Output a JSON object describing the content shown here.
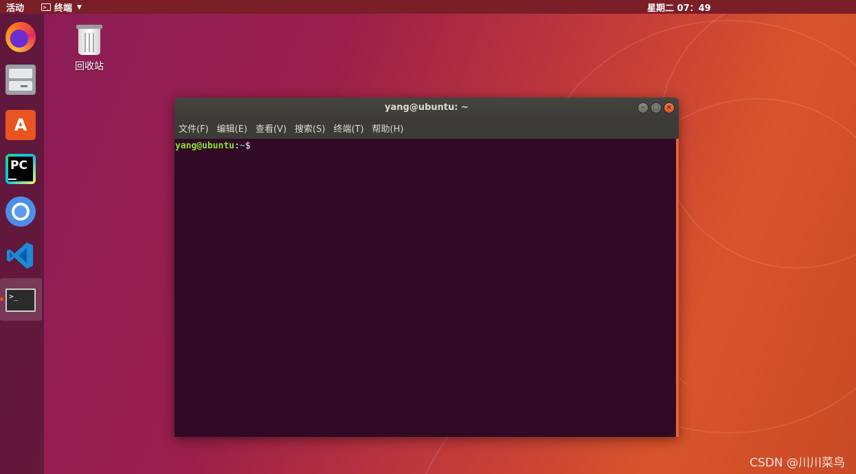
{
  "topbar": {
    "activities": "活动",
    "app_name": "终端",
    "app_icon": "terminal-icon",
    "clock": "星期二 07：49"
  },
  "dock": {
    "items": [
      {
        "name": "firefox",
        "icon": "firefox-icon"
      },
      {
        "name": "files",
        "icon": "file-cabinet-icon"
      },
      {
        "name": "software",
        "icon": "software-center-icon",
        "glyph": "A"
      },
      {
        "name": "pycharm",
        "icon": "pycharm-icon",
        "glyph": "PC"
      },
      {
        "name": "chromium",
        "icon": "chromium-icon"
      },
      {
        "name": "vscode",
        "icon": "vscode-icon"
      },
      {
        "name": "terminal",
        "icon": "terminal-icon",
        "glyph": ">_",
        "active": true
      }
    ]
  },
  "desktop": {
    "trash_label": "回收站",
    "trash_icon": "trash-icon"
  },
  "terminal": {
    "title": "yang@ubuntu: ~",
    "menu": [
      "文件(F)",
      "编辑(E)",
      "查看(V)",
      "搜索(S)",
      "终端(T)",
      "帮助(H)"
    ],
    "prompt_user": "yang@ubuntu",
    "prompt_colon": ":",
    "prompt_path": "~",
    "prompt_symbol": "$",
    "controls": {
      "minimize": "–",
      "maximize": "□",
      "close": "×"
    }
  },
  "watermark": "CSDN @川川菜鸟",
  "colors": {
    "accent": "#e95420",
    "terminal_bg": "#300a24",
    "prompt_user": "#8ae234",
    "prompt_path": "#729fcf"
  }
}
